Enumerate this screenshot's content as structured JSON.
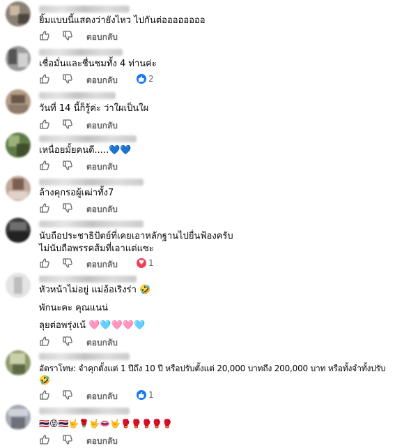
{
  "ui": {
    "reply_label": "ตอบกลับ"
  },
  "comments": [
    {
      "id": 1,
      "lines": [
        "ยิ้มแบบนี้แสดงว่ายังไหว ไปกันต่ออออออออ"
      ]
    },
    {
      "id": 2,
      "lines": [
        "เชื่อมั่นและชื่นชมทั้ง 4 ท่านค่ะ"
      ],
      "reaction": {
        "type": "like-reaction-icon",
        "count": "2",
        "color": "#1877f2"
      }
    },
    {
      "id": 3,
      "lines": [
        "วันที่ 14 นี้ก็รู้ค่ะ ว่าใผเป็นใผ"
      ]
    },
    {
      "id": 4,
      "lines": [
        "เหนื่อยมั้ยคนดี.....💙💙"
      ]
    },
    {
      "id": 5,
      "lines": [
        "ล้างคุกรอผู้เฒ่าทั้ง7"
      ]
    },
    {
      "id": 6,
      "lines": [
        "นับถือประชาธิปัตย์ที่เคยเอาหลักฐานไปยื่นฟ้องครับ",
        "ไม่นับถือพรรคส้มที่เอาแต่แซะ"
      ],
      "reaction": {
        "type": "love-reaction-icon",
        "count": "1",
        "color": "#f33e58"
      }
    },
    {
      "id": 7,
      "lines": [
        "หัวหน้าไม่อยู่ แม่อ้อเริงร่า 🤣",
        "พักนะคะ คุณแนน่",
        "ลุยต่อพรุ่งเน้ 🩷🩵🩷🩷🩵"
      ]
    },
    {
      "id": 8,
      "lines": [
        "อัตราโทษ: จำคุกตั้งแต่ 1 ปีถึง 10 ปี หรือปรับตั้งแต่ 20,000 บาทถึง 200,000 บาท หรือทั้งจำทั้งปรับ",
        "🤣"
      ],
      "reaction": {
        "type": "like-reaction-icon",
        "count": "1",
        "color": "#1877f2"
      }
    },
    {
      "id": 9,
      "lines": [
        "🇹🇭😝🇹🇭🤟🌹🤟👄🤟🥊🥊🥊🥊🥊"
      ]
    }
  ]
}
